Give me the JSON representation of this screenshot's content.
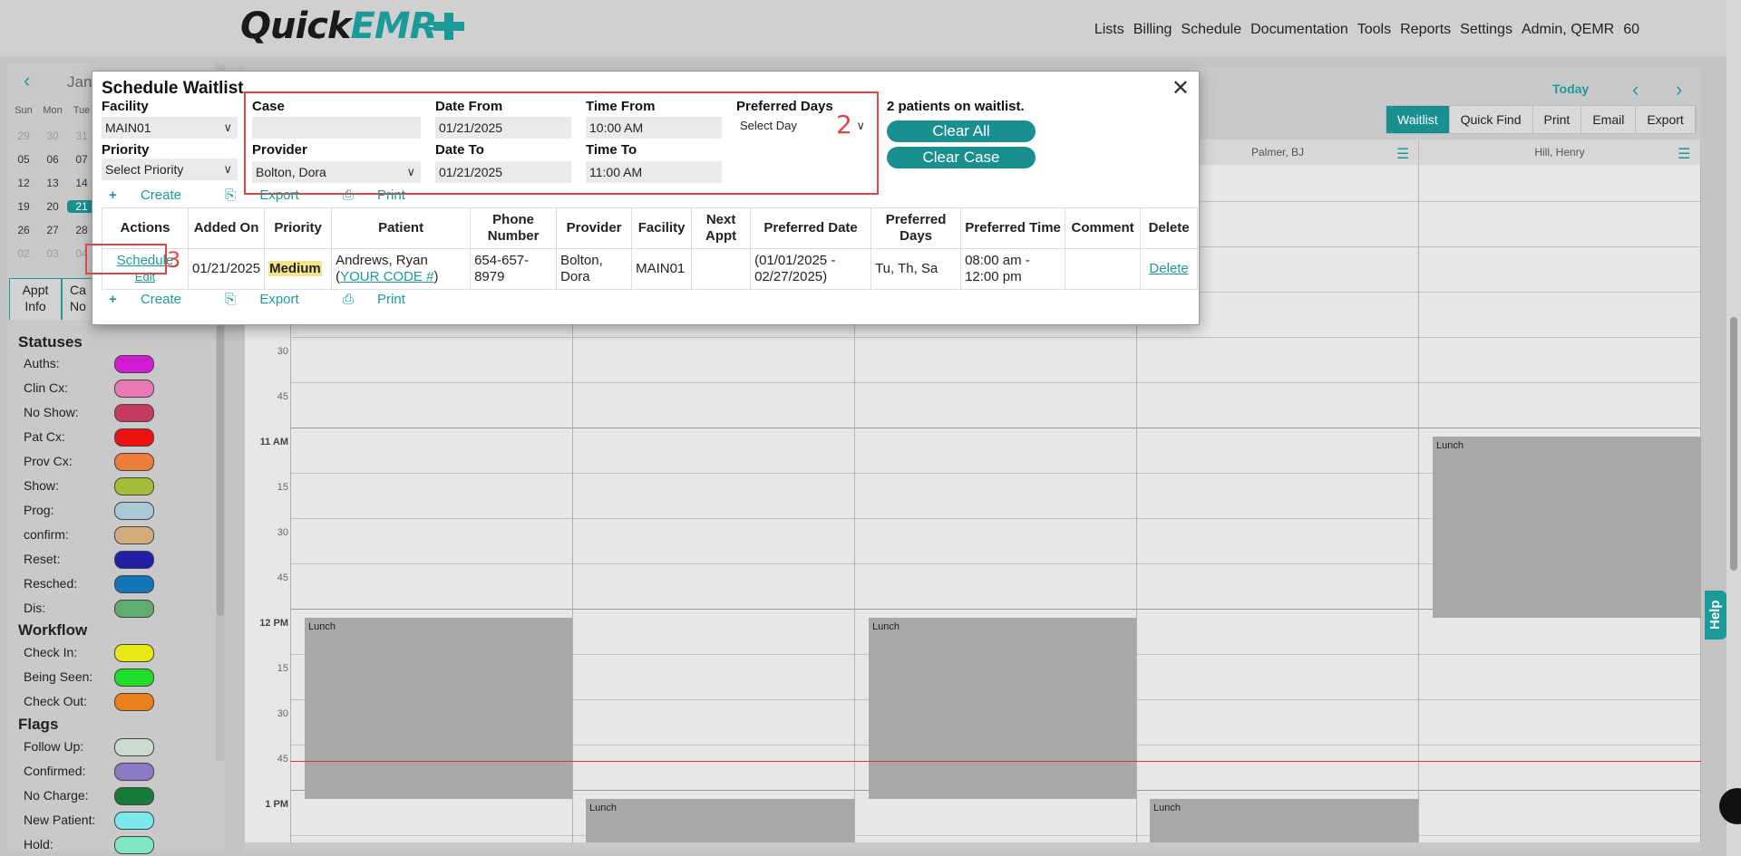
{
  "app": {
    "logo_main": "Quick",
    "logo_accent": "EMR"
  },
  "nav": [
    "Lists",
    "Billing",
    "Schedule",
    "Documentation",
    "Tools",
    "Reports",
    "Settings",
    "Admin, QEMR",
    "60"
  ],
  "mini_calendar": {
    "month": "Jan",
    "weekdays": [
      "Sun",
      "Mon",
      "Tue"
    ],
    "rows": [
      [
        "29",
        "30",
        "31"
      ],
      [
        "05",
        "06",
        "07"
      ],
      [
        "12",
        "13",
        "14"
      ],
      [
        "19",
        "20",
        "21"
      ],
      [
        "26",
        "27",
        "28"
      ],
      [
        "02",
        "03",
        "04"
      ]
    ],
    "selected": "21"
  },
  "left_tabs": {
    "appt_info": "Appt\nInfo",
    "second": "Ca\nNo"
  },
  "legend": {
    "statuses_title": "Statuses",
    "statuses": [
      {
        "label": "Auths:",
        "color": "#d21bd3"
      },
      {
        "label": "Clin Cx:",
        "color": "#e979b4"
      },
      {
        "label": "No Show:",
        "color": "#c43a5e"
      },
      {
        "label": "Pat Cx:",
        "color": "#ee1111"
      },
      {
        "label": "Prov Cx:",
        "color": "#ec7d3b"
      },
      {
        "label": "Show:",
        "color": "#a3bd3a"
      },
      {
        "label": "Prog:",
        "color": "#a7cad6"
      },
      {
        "label": "confirm:",
        "color": "#d4ab7b"
      },
      {
        "label": "Reset:",
        "color": "#1f1ea6"
      },
      {
        "label": "Resched:",
        "color": "#1375b8"
      },
      {
        "label": "Dis:",
        "color": "#5fae70"
      }
    ],
    "workflow_title": "Workflow",
    "workflow": [
      {
        "label": "Check In:",
        "color": "#e8e816"
      },
      {
        "label": "Being Seen:",
        "color": "#1ede2a"
      },
      {
        "label": "Check Out:",
        "color": "#e9801a"
      }
    ],
    "flags_title": "Flags",
    "flags": [
      {
        "label": "Follow Up:",
        "color": "#c9dccf"
      },
      {
        "label": "Confirmed:",
        "color": "#8c78c4"
      },
      {
        "label": "No Charge:",
        "color": "#167a3a"
      },
      {
        "label": "New Patient:",
        "color": "#7ae9ec"
      },
      {
        "label": "Hold:",
        "color": "#7ee6c5"
      }
    ]
  },
  "schedule": {
    "today": "Today",
    "view_buttons": [
      "Waitlist",
      "Quick Find",
      "Print",
      "Email",
      "Export"
    ],
    "active_view": "Waitlist",
    "columns": [
      "Palmer, BJ",
      "Hill, Henry"
    ],
    "time_labels": [
      {
        "text": "30",
        "hour": false
      },
      {
        "text": "45",
        "hour": false
      },
      {
        "text": "11 AM",
        "hour": true
      },
      {
        "text": "15",
        "hour": false
      },
      {
        "text": "30",
        "hour": false
      },
      {
        "text": "45",
        "hour": false
      },
      {
        "text": "12 PM",
        "hour": true
      },
      {
        "text": "15",
        "hour": false
      },
      {
        "text": "30",
        "hour": false
      },
      {
        "text": "45",
        "hour": false
      },
      {
        "text": "1 PM",
        "hour": true
      }
    ],
    "lunch_label": "Lunch"
  },
  "modal": {
    "title": "Schedule Waitlist",
    "facility_label": "Facility",
    "facility_value": "MAIN01",
    "priority_label": "Priority",
    "priority_value": "Select Priority",
    "case_label": "Case",
    "case_value": "",
    "provider_label": "Provider",
    "provider_value": "Bolton, Dora",
    "date_from_label": "Date From",
    "date_from_value": "01/21/2025",
    "date_to_label": "Date To",
    "date_to_value": "01/21/2025",
    "time_from_label": "Time From",
    "time_from_value": "10:00 AM",
    "time_to_label": "Time To",
    "time_to_value": "11:00 AM",
    "preferred_days_label": "Preferred Days",
    "preferred_days_value": "Select Day",
    "summary": "2 patients on waitlist.",
    "clear_all": "Clear All",
    "clear_case": "Clear Case",
    "create": "Create",
    "export": "Export",
    "print": "Print",
    "step2": "2",
    "step3": "3",
    "table": {
      "headers": [
        "Actions",
        "Added On",
        "Priority",
        "Patient",
        "Phone Number",
        "Provider",
        "Facility",
        "Next Appt",
        "Preferred Date",
        "Preferred Days",
        "Preferred Time",
        "Comment",
        "Delete"
      ],
      "row": {
        "schedule_link": "Schedule",
        "edit_link": "Edit",
        "added_on": "01/21/2025",
        "priority": "Medium",
        "patient_name": "Andrews, Ryan",
        "patient_code": "YOUR CODE #",
        "phone": "654-657-8979",
        "provider": "Bolton, Dora",
        "facility": "MAIN01",
        "next_appt": "",
        "preferred_date": "(01/01/2025 - 02/27/2025)",
        "preferred_days": "Tu, Th, Sa",
        "preferred_time": "08:00 am - 12:00 pm",
        "comment": "",
        "delete": "Delete"
      }
    }
  },
  "help": "Help"
}
